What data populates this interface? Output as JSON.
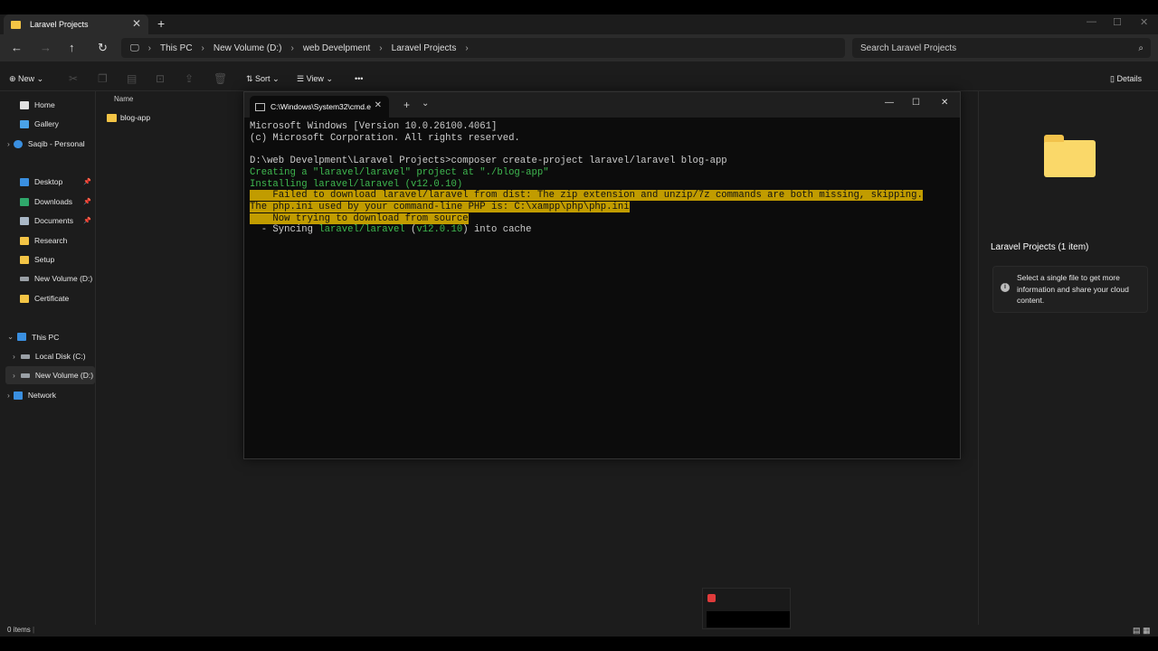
{
  "explorer": {
    "tab_title": "Laravel Projects",
    "breadcrumb": [
      "This PC",
      "New Volume (D:)",
      "web Develpment",
      "Laravel Projects"
    ],
    "search_placeholder": "Search Laravel Projects",
    "toolbar": {
      "new": "New",
      "sort": "Sort",
      "view": "View",
      "more": "•••",
      "details": "Details"
    },
    "sidebar": {
      "home": "Home",
      "gallery": "Gallery",
      "personal": "Saqib - Personal",
      "desktop": "Desktop",
      "downloads": "Downloads",
      "documents": "Documents",
      "research": "Research",
      "setup": "Setup",
      "newvolume": "New Volume (D:)",
      "certificate": "Certificate",
      "thispc": "This PC",
      "localdisk": "Local Disk (C:)",
      "newvolume2": "New Volume (D:)",
      "network": "Network"
    },
    "column_name": "Name",
    "files": [
      "blog-app"
    ],
    "details_title": "Laravel Projects (1 item)",
    "details_info": "Select a single file to get more information and share your cloud content.",
    "status": "0 items"
  },
  "cmd": {
    "tab_title": "C:\\Windows\\System32\\cmd.e",
    "lines": {
      "l1": "Microsoft Windows [Version 10.0.26100.4061]",
      "l2": "(c) Microsoft Corporation. All rights reserved.",
      "l3": "D:\\web Develpment\\Laravel Projects>composer create-project laravel/laravel blog-app",
      "l4": "Creating a \"laravel/laravel\" project at \"./blog-app\"",
      "l5": "Installing laravel/laravel (v12.0.10)",
      "l6": "    Failed to download laravel/laravel from dist: The zip extension and unzip/7z commands are both missing, skipping.",
      "l7": "The php.ini used by your command-line PHP is: C:\\xampp\\php\\php.ini",
      "l8": "    Now trying to download from source",
      "l9a": "  - Syncing ",
      "l9b": "laravel/laravel",
      "l9c": " (",
      "l9d": "v12.0.10",
      "l9e": ") into cache"
    }
  }
}
